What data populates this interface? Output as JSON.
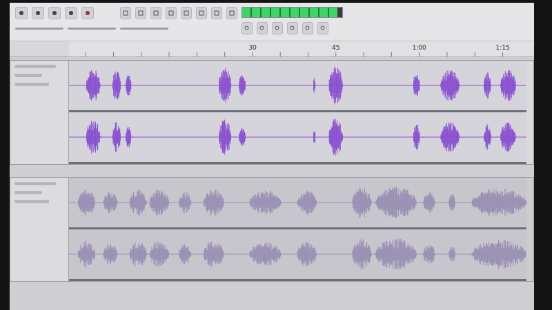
{
  "toolbar": {
    "meter": {
      "level": 0.95
    }
  },
  "ruler": {
    "ticks": [
      {
        "label": "30",
        "seconds": 30
      },
      {
        "label": "45",
        "seconds": 45
      },
      {
        "label": "1:00",
        "seconds": 60
      },
      {
        "label": "1:15",
        "seconds": 75
      }
    ]
  },
  "tracks": [
    {
      "selected": true,
      "color": "#8a4fd0",
      "segments": [
        [
          0.1,
          2.6,
          0.8
        ],
        [
          4.8,
          6.3,
          0.7
        ],
        [
          7.2,
          8.2,
          0.5
        ],
        [
          24,
          26.2,
          0.8
        ],
        [
          27.6,
          28.8,
          0.5
        ],
        [
          41,
          41.4,
          0.4
        ],
        [
          43.8,
          46.3,
          0.85
        ],
        [
          59,
          60.2,
          0.6
        ],
        [
          63.9,
          67.3,
          0.7
        ],
        [
          71.7,
          73,
          0.6
        ],
        [
          74.7,
          77.5,
          0.7
        ]
      ]
    },
    {
      "selected": false,
      "color": "#9a90b4",
      "segments": [
        [
          -1.4,
          1.7,
          0.6
        ],
        [
          3.2,
          5.7,
          0.5
        ],
        [
          7.9,
          11,
          0.6
        ],
        [
          11.5,
          15,
          0.6
        ],
        [
          16.8,
          19,
          0.5
        ],
        [
          21.2,
          24.9,
          0.6
        ],
        [
          29.5,
          35.2,
          0.55
        ],
        [
          38.1,
          41.6,
          0.55
        ],
        [
          48,
          51.5,
          0.7
        ],
        [
          52.2,
          59.6,
          0.7
        ],
        [
          60.8,
          62.9,
          0.5
        ],
        [
          65.4,
          66.6,
          0.4
        ],
        [
          69.5,
          79.4,
          0.65
        ]
      ]
    }
  ]
}
